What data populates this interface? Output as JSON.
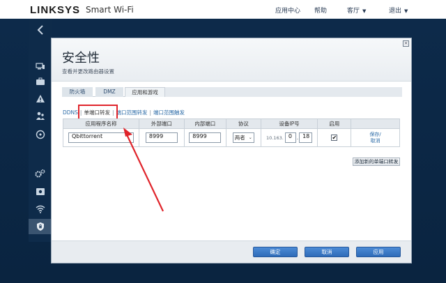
{
  "header": {
    "brand": "LINKSYS",
    "product": "Smart Wi-Fi",
    "nav": [
      {
        "label": "应用中心",
        "caret": ""
      },
      {
        "label": "帮助",
        "caret": ""
      },
      {
        "label": "客厅",
        "caret": "▼"
      },
      {
        "label": "退出",
        "caret": "▼"
      }
    ]
  },
  "sidebar": {
    "icons": [
      "back-chevron-icon",
      "devices-icon",
      "toolbox-icon",
      "warning-icon",
      "parental-icon",
      "media-icon",
      "settings-gear-icon",
      "storage-icon",
      "wifi-icon",
      "security-shield-icon"
    ]
  },
  "dialog": {
    "title": "安全性",
    "subtitle": "查看并更改路由器设置",
    "tabs": [
      "防火墙",
      "DMZ",
      "应用和游戏"
    ],
    "subnav": {
      "items": [
        "DDNS",
        "单端口转发",
        "端口范围转发",
        "端口范围触发"
      ]
    },
    "table": {
      "headers": [
        "应用程序名称",
        "外部端口",
        "内部端口",
        "协议",
        "设备IP号",
        "启用",
        ""
      ],
      "row": {
        "app_name": "Qbittorrent",
        "external_port": "8999",
        "internal_port": "8999",
        "protocol": "两者",
        "ip_prefix": "10.163.",
        "ip_octet3": "0",
        "ip_octet4": "18",
        "enabled": "✔",
        "save": "保存/",
        "cancel": "取消"
      }
    },
    "add_button": "添加新的单端口转发",
    "footer": {
      "ok": "确定",
      "cancel": "取消",
      "apply": "应用"
    }
  },
  "colors": {
    "accent_blue": "#2e6bb8",
    "highlight_red": "#e0242b",
    "navy_bg": "#0c2745"
  }
}
